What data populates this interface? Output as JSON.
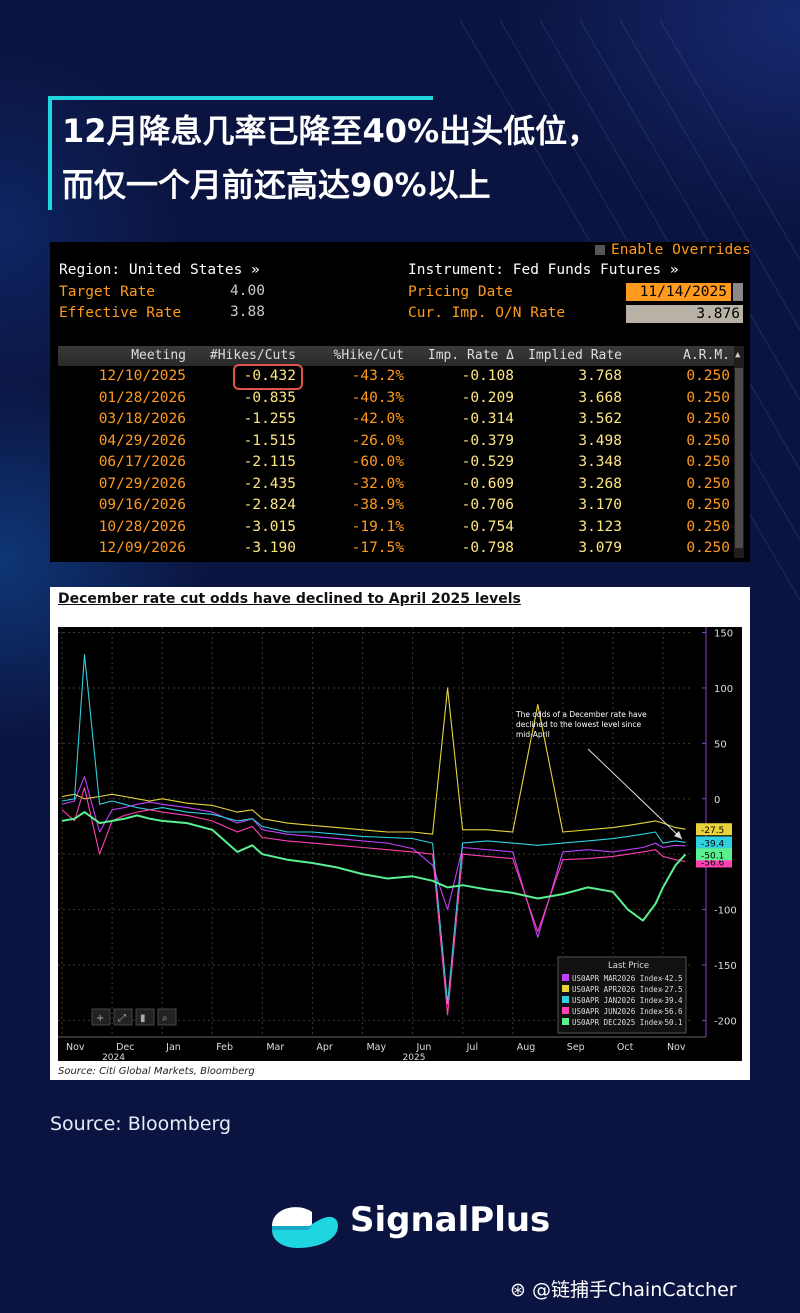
{
  "title": {
    "line1": "12月降息几率已降至40%出头低位，",
    "line2": "而仅一个月前还高达90%以上"
  },
  "terminal": {
    "enable_overrides": "Enable Overrides",
    "region_label": "Region: United States »",
    "instrument_label": "Instrument: Fed Funds Futures »",
    "target_rate_label": "Target Rate",
    "target_rate_value": "4.00",
    "effective_rate_label": "Effective Rate",
    "effective_rate_value": "3.88",
    "pricing_date_label": "Pricing Date",
    "pricing_date_value": "11/14/2025",
    "cur_imp_label": "Cur. Imp. O/N Rate",
    "cur_imp_value": "3.876",
    "columns": [
      "Meeting",
      "#Hikes/Cuts",
      "%Hike/Cut",
      "Imp. Rate Δ",
      "Implied Rate",
      "A.R.M."
    ],
    "rows": [
      [
        "12/10/2025",
        "-0.432",
        "-43.2%",
        "-0.108",
        "3.768",
        "0.250"
      ],
      [
        "01/28/2026",
        "-0.835",
        "-40.3%",
        "-0.209",
        "3.668",
        "0.250"
      ],
      [
        "03/18/2026",
        "-1.255",
        "-42.0%",
        "-0.314",
        "3.562",
        "0.250"
      ],
      [
        "04/29/2026",
        "-1.515",
        "-26.0%",
        "-0.379",
        "3.498",
        "0.250"
      ],
      [
        "06/17/2026",
        "-2.115",
        "-60.0%",
        "-0.529",
        "3.348",
        "0.250"
      ],
      [
        "07/29/2026",
        "-2.435",
        "-32.0%",
        "-0.609",
        "3.268",
        "0.250"
      ],
      [
        "09/16/2026",
        "-2.824",
        "-38.9%",
        "-0.706",
        "3.170",
        "0.250"
      ],
      [
        "10/28/2026",
        "-3.015",
        "-19.1%",
        "-0.754",
        "3.123",
        "0.250"
      ],
      [
        "12/09/2026",
        "-3.190",
        "-17.5%",
        "-0.798",
        "3.079",
        "0.250"
      ]
    ],
    "colors": {
      "label": "#ff9a1f",
      "value": "#ffe680",
      "highlight": "#e0554a"
    }
  },
  "chart_data": {
    "type": "line",
    "title": "December rate cut odds have declined to April 2025 levels",
    "source": "Source: Citi Global Markets, Bloomberg",
    "annotation": [
      "The odds of a December rate have",
      "declined to the lowest level since",
      "mid-April"
    ],
    "x_ticks": [
      "Nov",
      "Dec",
      "Jan",
      "Feb",
      "Mar",
      "Apr",
      "May",
      "Jun",
      "Jul",
      "Aug",
      "Sep",
      "Oct",
      "Nov"
    ],
    "x_year_labels": [
      {
        "label": "2024",
        "at": 1
      },
      {
        "label": "2025",
        "at": 7
      }
    ],
    "ylim": [
      -215,
      155
    ],
    "y_ticks": [
      150,
      100,
      50,
      0,
      -50,
      -100,
      -150,
      -200
    ],
    "grid": true,
    "legend_position": "bottom-right",
    "legend_title": "Last Price",
    "x_months": [
      0,
      0.25,
      0.45,
      0.75,
      1,
      1.25,
      1.5,
      1.75,
      2,
      2.5,
      3,
      3.5,
      3.8,
      4,
      4.5,
      5,
      5.5,
      6,
      6.5,
      7,
      7.4,
      7.7,
      8,
      8.5,
      9,
      9.5,
      10,
      10.5,
      11,
      11.3,
      11.6,
      11.85,
      12,
      12.25,
      12.45
    ],
    "series": [
      {
        "name": "US0APR MAR2026 Index",
        "last": "-42.5",
        "color": "#c040ff",
        "values": [
          -5,
          -2,
          20,
          -30,
          -10,
          -8,
          -5,
          -3,
          -5,
          -8,
          -12,
          -22,
          -18,
          -28,
          -32,
          -34,
          -36,
          -38,
          -40,
          -45,
          -60,
          -100,
          -44,
          -46,
          -48,
          -125,
          -48,
          -46,
          -48,
          -46,
          -44,
          -40,
          -44,
          -42,
          -42.5
        ]
      },
      {
        "name": "US0APR APR2026 Index",
        "last": "-27.5",
        "color": "#e8d43a",
        "values": [
          2,
          4,
          0,
          2,
          4,
          2,
          0,
          -2,
          0,
          -4,
          -6,
          -12,
          -10,
          -18,
          -22,
          -24,
          -26,
          -28,
          -30,
          -30,
          -32,
          100,
          -28,
          -28,
          -30,
          85,
          -30,
          -28,
          -26,
          -24,
          -22,
          -20,
          -22,
          -26,
          -27.5
        ]
      },
      {
        "name": "US0APR JAN2026 Index",
        "last": "-39.4",
        "color": "#30d0e0",
        "values": [
          -2,
          0,
          130,
          -5,
          -2,
          -5,
          -8,
          -10,
          -8,
          -12,
          -14,
          -20,
          -18,
          -25,
          -30,
          -30,
          -32,
          -34,
          -35,
          -36,
          -40,
          -185,
          -40,
          -38,
          -40,
          -42,
          -40,
          -38,
          -36,
          -34,
          -32,
          -30,
          -40,
          -38,
          -39.4
        ]
      },
      {
        "name": "US0APR JUN2026 Index",
        "last": "-56.6",
        "color": "#ff40b0",
        "values": [
          -10,
          -20,
          10,
          -50,
          -20,
          -15,
          -12,
          -10,
          -12,
          -15,
          -20,
          -30,
          -25,
          -35,
          -38,
          -40,
          -42,
          -44,
          -46,
          -48,
          -50,
          -195,
          -50,
          -52,
          -54,
          -120,
          -55,
          -54,
          -52,
          -50,
          -48,
          -46,
          -52,
          -55,
          -56.6
        ]
      },
      {
        "name": "US0APR DEC2025 Index",
        "last": "-50.1",
        "color": "#58f090",
        "values": [
          -20,
          -18,
          -12,
          -22,
          -20,
          -18,
          -15,
          -18,
          -20,
          -22,
          -28,
          -48,
          -42,
          -50,
          -55,
          -58,
          -62,
          -68,
          -72,
          -70,
          -74,
          -80,
          -78,
          -82,
          -85,
          -90,
          -86,
          -80,
          -84,
          -100,
          -110,
          -95,
          -80,
          -60,
          -50.1
        ]
      }
    ]
  },
  "footer": {
    "source": "Source: Bloomberg",
    "brand": "SignalPlus",
    "watermark": "@链捕手ChainCatcher",
    "logo_color": "#1fd6e0"
  }
}
